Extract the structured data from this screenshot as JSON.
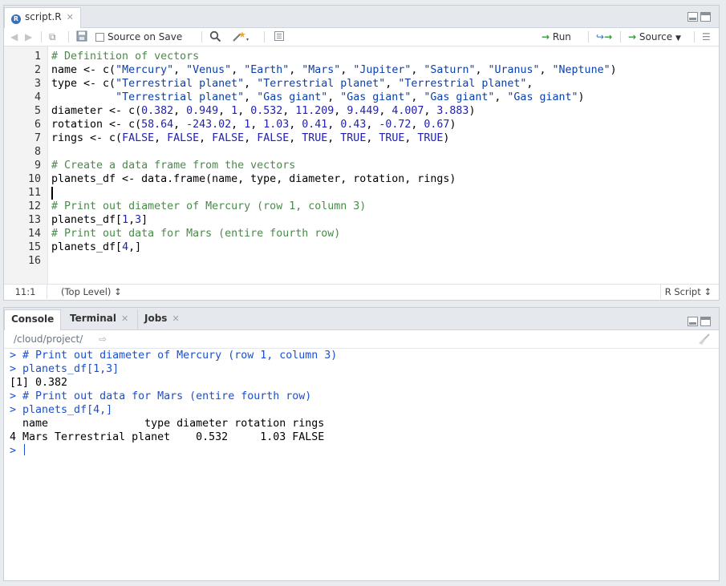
{
  "editor": {
    "tab_title": "script.R",
    "toolbar": {
      "source_on_save": "Source on Save",
      "run": "Run",
      "source": "Source"
    },
    "lines": [
      {
        "n": "1",
        "text": "# Definition of vectors"
      },
      {
        "n": "2",
        "text": "name <- c(\"Mercury\", \"Venus\", \"Earth\", \"Mars\", \"Jupiter\", \"Saturn\", \"Uranus\", \"Neptune\")"
      },
      {
        "n": "3",
        "text": "type <- c(\"Terrestrial planet\", \"Terrestrial planet\", \"Terrestrial planet\","
      },
      {
        "n": "4",
        "text": "          \"Terrestrial planet\", \"Gas giant\", \"Gas giant\", \"Gas giant\", \"Gas giant\")"
      },
      {
        "n": "5",
        "text": "diameter <- c(0.382, 0.949, 1, 0.532, 11.209, 9.449, 4.007, 3.883)"
      },
      {
        "n": "6",
        "text": "rotation <- c(58.64, -243.02, 1, 1.03, 0.41, 0.43, -0.72, 0.67)"
      },
      {
        "n": "7",
        "text": "rings <- c(FALSE, FALSE, FALSE, FALSE, TRUE, TRUE, TRUE, TRUE)"
      },
      {
        "n": "8",
        "text": ""
      },
      {
        "n": "9",
        "text": "# Create a data frame from the vectors"
      },
      {
        "n": "10",
        "text": "planets_df <- data.frame(name, type, diameter, rotation, rings)"
      },
      {
        "n": "11",
        "text": ""
      },
      {
        "n": "12",
        "text": "# Print out diameter of Mercury (row 1, column 3)"
      },
      {
        "n": "13",
        "text": "planets_df[1,3]"
      },
      {
        "n": "14",
        "text": "# Print out data for Mars (entire fourth row)"
      },
      {
        "n": "15",
        "text": "planets_df[4,]"
      },
      {
        "n": "16",
        "text": ""
      }
    ],
    "status": {
      "position": "11:1",
      "scope": "(Top Level) ↕",
      "file_type": "R Script ↕"
    }
  },
  "console_pane": {
    "tabs": [
      {
        "label": "Console"
      },
      {
        "label": "Terminal"
      },
      {
        "label": "Jobs"
      }
    ],
    "path": "/cloud/project/",
    "lines": [
      {
        "kind": "cmd",
        "prompt": "> ",
        "text": "# Print out diameter of Mercury (row 1, column 3)"
      },
      {
        "kind": "cmd",
        "prompt": "> ",
        "text": "planets_df[1,3]"
      },
      {
        "kind": "out",
        "prompt": "",
        "text": "[1] 0.382"
      },
      {
        "kind": "cmd",
        "prompt": "> ",
        "text": "# Print out data for Mars (entire fourth row)"
      },
      {
        "kind": "cmd",
        "prompt": "> ",
        "text": "planets_df[4,]"
      },
      {
        "kind": "out",
        "prompt": "",
        "text": "  name               type diameter rotation rings"
      },
      {
        "kind": "out",
        "prompt": "",
        "text": "4 Mars Terrestrial planet    0.532     1.03 FALSE"
      },
      {
        "kind": "cmd",
        "prompt": "> ",
        "text": ""
      }
    ]
  }
}
